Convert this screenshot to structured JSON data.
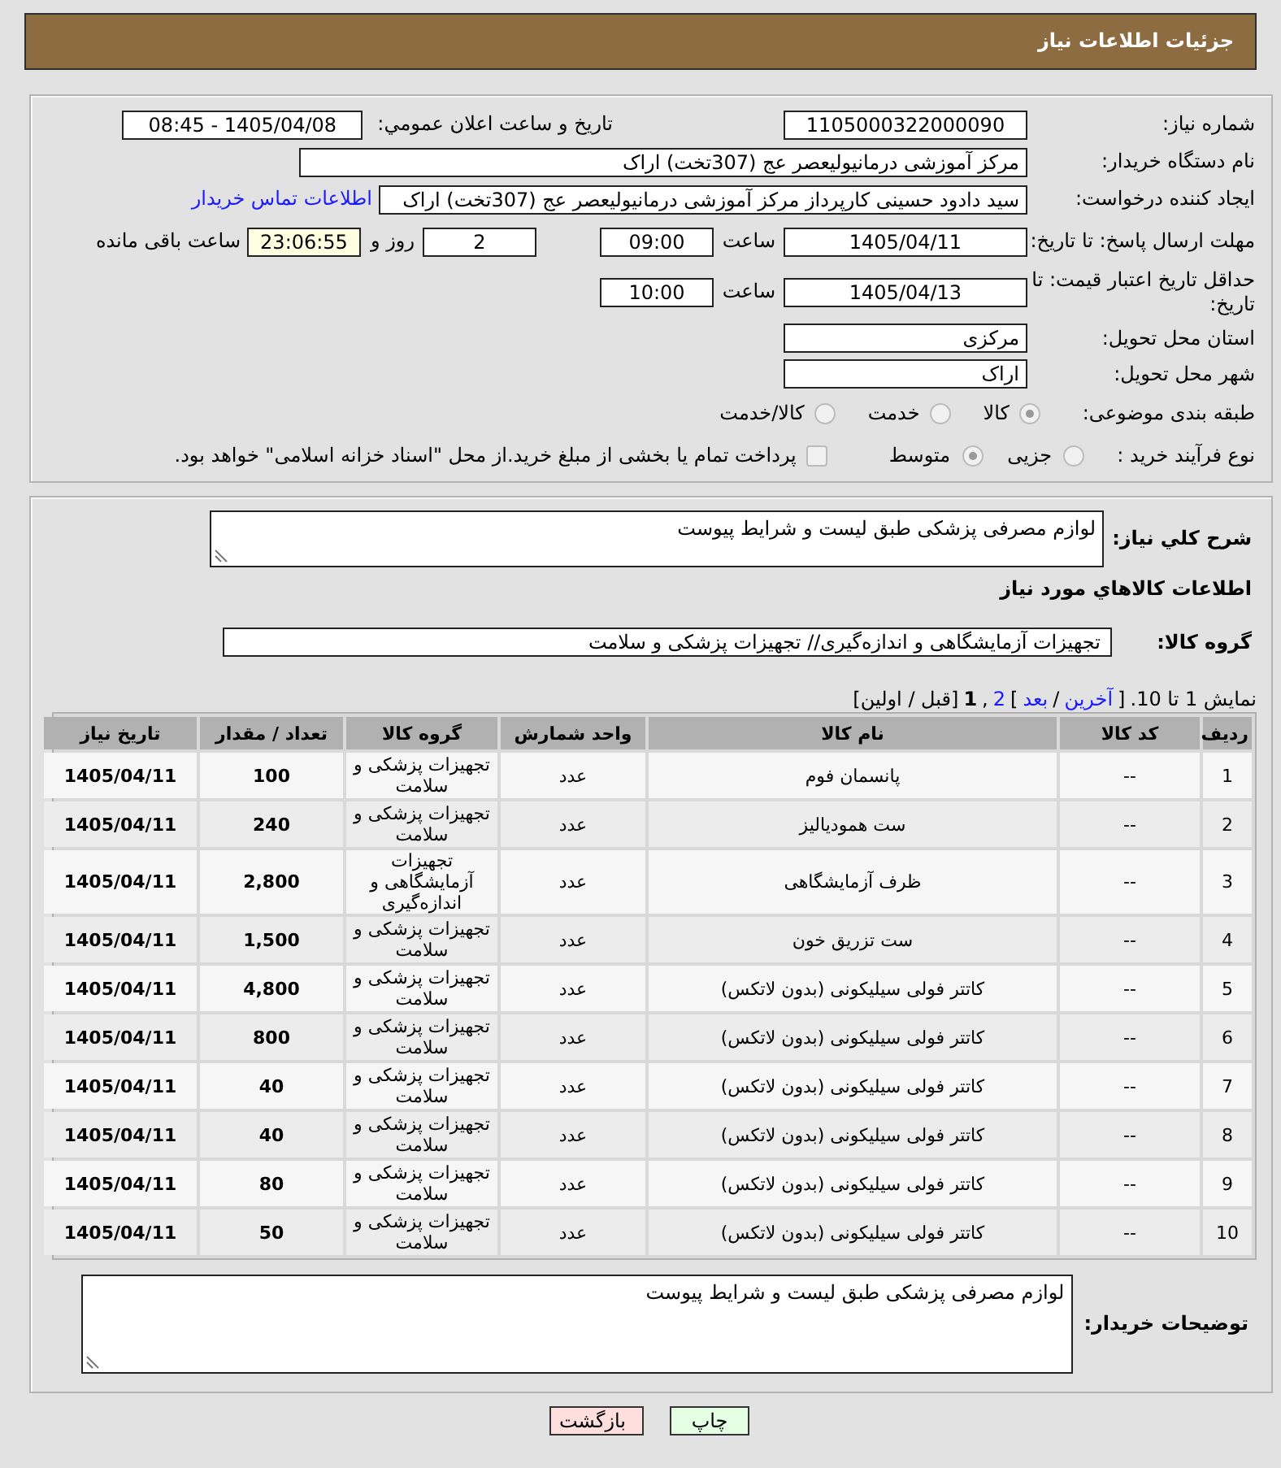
{
  "header": {
    "title": "جزئیات اطلاعات نیاز"
  },
  "details": {
    "need_number": {
      "label": "شماره نیاز:",
      "value": "1105000322000090"
    },
    "announcement": {
      "label": "تاریخ و ساعت اعلان عمومي:",
      "value": "1405/04/08 - 08:45"
    },
    "buyer_org": {
      "label": "نام دستگاه خریدار:",
      "value": "مرکز آموزشی درمانیولیعصر عج (307تخت) اراک"
    },
    "requester": {
      "label": "ایجاد کننده درخواست:",
      "value": "سید دادود حسینی کارپرداز مرکز آموزشی درمانیولیعصر عج (307تخت) اراک",
      "link": "اطلاعات تماس خریدار"
    },
    "reply_deadline": {
      "label": "مهلت ارسال پاسخ: تا تاریخ:",
      "date": "1405/04/11",
      "time_label": "ساعت",
      "time": "09:00",
      "days": "2",
      "days_label": "روز و",
      "remaining": "23:06:55",
      "remaining_label": "ساعت باقی مانده"
    },
    "price_validity": {
      "label": "حداقل تاریخ اعتبار قیمت: تا تاریخ:",
      "date": "1405/04/13",
      "time_label": "ساعت",
      "time": "10:00"
    },
    "province": {
      "label": "استان محل تحویل:",
      "value": "مرکزی"
    },
    "city": {
      "label": "شهر محل تحویل:",
      "value": "اراک"
    },
    "classification": {
      "label": "طبقه بندی موضوعی:",
      "disabled": true,
      "options": [
        {
          "label": "کالا",
          "selected": true
        },
        {
          "label": "خدمت",
          "selected": false
        },
        {
          "label": "کالا/خدمت",
          "selected": false
        }
      ]
    },
    "purchase_type": {
      "label": "نوع فرآیند خرید :",
      "disabled": true,
      "options": [
        {
          "label": "جزیی",
          "selected": false
        },
        {
          "label": "متوسط",
          "selected": true
        }
      ],
      "treasury": {
        "label": "پرداخت تمام یا بخشی از مبلغ خرید.از محل \"اسناد خزانه اسلامی\" خواهد بود.",
        "checked": false,
        "disabled": true
      }
    }
  },
  "need": {
    "description_label": "شرح کلي نیاز:",
    "description": "لوازم مصرفی پزشکی طبق لیست و شرایط پیوست",
    "items_title": "اطلاعات کالاهاي مورد نیاز",
    "group_label": "گروه کالا:",
    "group": "تجهیزات آزمایشگاهی و اندازه‌گیری// تجهیزات پزشکی و سلامت"
  },
  "pagination": [
    {
      "kind": "text",
      "text": "نمایش 1 تا 10."
    },
    {
      "kind": "text",
      "text": "["
    },
    {
      "kind": "link",
      "text": "آخرین"
    },
    {
      "kind": "text",
      "text": "/"
    },
    {
      "kind": "link",
      "text": "بعد"
    },
    {
      "kind": "text",
      "text": "]"
    },
    {
      "kind": "link",
      "text": "2"
    },
    {
      "kind": "text",
      "text": ","
    },
    {
      "kind": "current",
      "text": "1"
    },
    {
      "kind": "text",
      "text": "[قبل / اولین]"
    }
  ],
  "table": {
    "columns": [
      "ردیف",
      "کد کالا",
      "نام کالا",
      "واحد شمارش",
      "گروه کالا",
      "تعداد / مقدار",
      "تاریخ نیاز"
    ],
    "rows": [
      [
        "1",
        "--",
        "پانسمان فوم",
        "عدد",
        "تجهیزات پزشکی و سلامت",
        "100",
        "1405/04/11"
      ],
      [
        "2",
        "--",
        "ست همودیالیز",
        "عدد",
        "تجهیزات پزشکی و سلامت",
        "240",
        "1405/04/11"
      ],
      [
        "3",
        "--",
        "ظرف آزمایشگاهی",
        "عدد",
        "تجهیزات آزمایشگاهی و اندازه‌گیری",
        "2,800",
        "1405/04/11"
      ],
      [
        "4",
        "--",
        "ست تزریق خون",
        "عدد",
        "تجهیزات پزشکی و سلامت",
        "1,500",
        "1405/04/11"
      ],
      [
        "5",
        "--",
        "کاتتر فولی سیلیکونی (بدون لاتکس)",
        "عدد",
        "تجهیزات پزشکی و سلامت",
        "4,800",
        "1405/04/11"
      ],
      [
        "6",
        "--",
        "کاتتر فولی سیلیکونی (بدون لاتکس)",
        "عدد",
        "تجهیزات پزشکی و سلامت",
        "800",
        "1405/04/11"
      ],
      [
        "7",
        "--",
        "کاتتر فولی سیلیکونی (بدون لاتکس)",
        "عدد",
        "تجهیزات پزشکی و سلامت",
        "40",
        "1405/04/11"
      ],
      [
        "8",
        "--",
        "کاتتر فولی سیلیکونی (بدون لاتکس)",
        "عدد",
        "تجهیزات پزشکی و سلامت",
        "40",
        "1405/04/11"
      ],
      [
        "9",
        "--",
        "کاتتر فولی سیلیکونی (بدون لاتکس)",
        "عدد",
        "تجهیزات پزشکی و سلامت",
        "80",
        "1405/04/11"
      ],
      [
        "10",
        "--",
        "کاتتر فولی سیلیکونی (بدون لاتکس)",
        "عدد",
        "تجهیزات پزشکی و سلامت",
        "50",
        "1405/04/11"
      ]
    ]
  },
  "buyer_notes": {
    "label": "توضیحات خریدار:",
    "value": "لوازم مصرفی پزشکی طبق لیست و شرایط پیوست"
  },
  "buttons": [
    {
      "kind": "print",
      "label": "چاپ"
    },
    {
      "kind": "back",
      "label": "بازگشت"
    }
  ]
}
